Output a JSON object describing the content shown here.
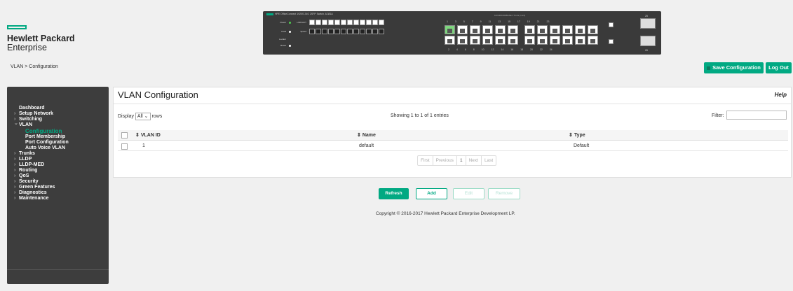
{
  "header": {
    "logo_line1": "Hewlett Packard",
    "logo_line2": "Enterprise",
    "breadcrumb": "VLAN > Configuration",
    "save_label": "Save Configuration",
    "logout_label": "Log Out"
  },
  "switch_panel": {
    "title": "HPE OfficeConnect 1920S 24G 2SFP Switch JL381A",
    "top_ports": "1 3 5 7 9 11 13 15 17 19 21 23",
    "bottom_ports": "2 4 6 8 10 12 14 16 18 20 22 24",
    "ports_label": "10/100/1000BASE-T Ports (1-24)",
    "sfp_top": "25",
    "sfp_bottom": "26",
    "power_label": "Power",
    "fault_label": "Fault",
    "locator_label": "Locator",
    "reset_label": "Reset",
    "link_act_label": "LINK/ACT",
    "speed_label": "Speed"
  },
  "sidebar": {
    "items": [
      {
        "label": "Dashboard",
        "kind": "plain"
      },
      {
        "label": "Setup Network",
        "kind": "tri"
      },
      {
        "label": "Switching",
        "kind": "tri"
      },
      {
        "label": "VLAN",
        "kind": "open"
      },
      {
        "label": "Configuration",
        "kind": "current"
      },
      {
        "label": "Port Membership",
        "kind": "sub"
      },
      {
        "label": "Port Configuration",
        "kind": "sub"
      },
      {
        "label": "Auto Voice VLAN",
        "kind": "sub"
      },
      {
        "label": "Trunks",
        "kind": "tri"
      },
      {
        "label": "LLDP",
        "kind": "tri"
      },
      {
        "label": "LLDP-MED",
        "kind": "tri"
      },
      {
        "label": "Routing",
        "kind": "tri"
      },
      {
        "label": "QoS",
        "kind": "tri"
      },
      {
        "label": "Security",
        "kind": "tri"
      },
      {
        "label": "Green Features",
        "kind": "tri"
      },
      {
        "label": "Diagnostics",
        "kind": "tri"
      },
      {
        "label": "Maintenance",
        "kind": "tri"
      }
    ]
  },
  "main": {
    "title": "VLAN Configuration",
    "help": "Help",
    "display_prefix": "Display",
    "display_value": "All",
    "display_suffix": "rows",
    "showing": "Showing 1 to 1 of 1 entries",
    "filter_label": "Filter:",
    "columns": [
      "VLAN ID",
      "Name",
      "Type"
    ],
    "rows": [
      {
        "id": "1",
        "name": "default",
        "type": "Default"
      }
    ],
    "pager": {
      "first": "First",
      "previous": "Previous",
      "page": "1",
      "next": "Next",
      "last": "Last"
    }
  },
  "actions": {
    "refresh": "Refresh",
    "add": "Add",
    "edit": "Edit",
    "remove": "Remove"
  },
  "footer": {
    "copyright": "Copyright © 2016-2017 Hewlett Packard Enterprise Development LP."
  },
  "colors": {
    "accent": "#01a982",
    "sidebar_bg": "#3d3d3d",
    "page_bg": "#f0f0f0"
  }
}
